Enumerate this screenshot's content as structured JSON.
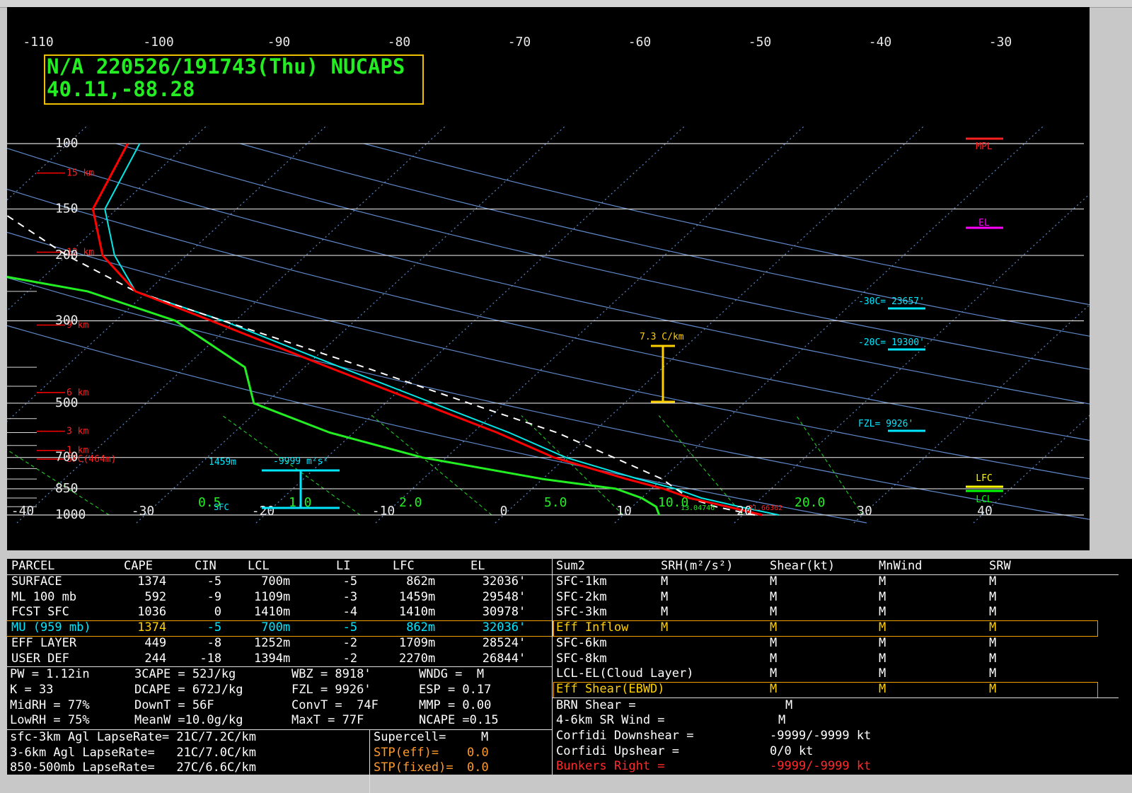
{
  "header": {
    "line1": "N/A 220526/191743(Thu) NUCAPS",
    "line2": "40.11,-88.28"
  },
  "chart_data": {
    "type": "skew-t",
    "pressure_levels": [
      100,
      150,
      200,
      300,
      500,
      700,
      850,
      1000
    ],
    "pressure_ticks_unlabeled": [
      250,
      400,
      450,
      550,
      600,
      650,
      750,
      800,
      900,
      950
    ],
    "temperature_ticks_top": [
      -110,
      -100,
      -90,
      -80,
      -70,
      -60,
      -50,
      -40,
      -30
    ],
    "temperature_ticks_bottom": [
      -40,
      -30,
      -20,
      -10,
      0,
      10,
      20,
      30,
      40
    ],
    "height_labels": [
      "15 km",
      "12 km",
      "9 km",
      "6 km",
      "3 km",
      "1 km",
      "SFC(464m)"
    ],
    "mixing_ratio_labels": [
      "0.5",
      "1.0",
      "2.0",
      "5.0",
      "10.0",
      "20.0"
    ],
    "temperature_profile": [
      [
        1000,
        21.6
      ],
      [
        950,
        18
      ],
      [
        900,
        14
      ],
      [
        850,
        11
      ],
      [
        800,
        7
      ],
      [
        700,
        -1
      ],
      [
        600,
        -8
      ],
      [
        500,
        -17
      ],
      [
        400,
        -28
      ],
      [
        300,
        -42
      ],
      [
        250,
        -51
      ],
      [
        200,
        -57
      ],
      [
        150,
        -62
      ],
      [
        100,
        -65
      ]
    ],
    "virtual_temperature_profile": [
      [
        1000,
        23
      ],
      [
        950,
        19
      ],
      [
        900,
        15
      ],
      [
        850,
        12
      ],
      [
        800,
        8
      ],
      [
        700,
        0
      ],
      [
        600,
        -7
      ],
      [
        500,
        -16
      ],
      [
        400,
        -27
      ],
      [
        300,
        -41
      ],
      [
        250,
        -51
      ],
      [
        200,
        -56
      ],
      [
        150,
        -61
      ],
      [
        100,
        -64
      ]
    ],
    "dewpoint_profile": [
      [
        1000,
        13
      ],
      [
        950,
        12
      ],
      [
        900,
        10
      ],
      [
        850,
        7
      ],
      [
        800,
        0
      ],
      [
        700,
        -12
      ],
      [
        600,
        -22
      ],
      [
        500,
        -31
      ],
      [
        400,
        -35
      ],
      [
        300,
        -45
      ],
      [
        250,
        -55
      ],
      [
        200,
        -75
      ],
      [
        150,
        -83
      ],
      [
        100,
        -90
      ]
    ],
    "parcel_trace": [
      [
        1000,
        21
      ],
      [
        950,
        17
      ],
      [
        900,
        14
      ],
      [
        850,
        12
      ],
      [
        800,
        10
      ],
      [
        700,
        4
      ],
      [
        600,
        -3
      ],
      [
        500,
        -13
      ],
      [
        400,
        -25
      ],
      [
        300,
        -41
      ],
      [
        250,
        -51
      ],
      [
        200,
        -60
      ],
      [
        150,
        -70
      ],
      [
        100,
        -82
      ]
    ],
    "surface_labels": {
      "temperature": "21.66362",
      "dewpoint": "13.04746"
    },
    "lapse_rate_label": "7.3 C/km",
    "effective_inflow": {
      "base_label": "1459m",
      "srh_label": "-9999 m²s²"
    },
    "sfc_label": "SFC",
    "right_markers": [
      {
        "label": "-30C= 23657'",
        "color": "#00e8ff"
      },
      {
        "label": "-20C= 19300'",
        "color": "#00e8ff"
      },
      {
        "label": "FZL= 9926'",
        "color": "#00e8ff"
      },
      {
        "label": "MPL",
        "color": "#ff2020"
      },
      {
        "label": "EL",
        "color": "#ff00ff"
      },
      {
        "label": "LFC",
        "color": "#ffff00"
      },
      {
        "label": "LCL",
        "color": "#00ff00"
      }
    ],
    "colors": {
      "temperature": "#ff0000",
      "virtual_temperature": "#00e8e8",
      "dewpoint": "#22ee22",
      "parcel": "#ffffff",
      "isobar": "#d8d8d8",
      "isotherm": "#5e88c8",
      "mixing_ratio": "#22cc22",
      "height": "#ff0000"
    }
  },
  "parcel_table": {
    "headers": [
      "PARCEL",
      "CAPE",
      "CIN",
      "LCL",
      "LI",
      "LFC",
      "EL"
    ],
    "rows": [
      [
        "SURFACE",
        "1374",
        "-5",
        "700m",
        "-5",
        "862m",
        "32036'"
      ],
      [
        "ML 100 mb",
        "592",
        "-9",
        "1109m",
        "-3",
        "1459m",
        "29548'"
      ],
      [
        "FCST SFC",
        "1036",
        "0",
        "1410m",
        "-4",
        "1410m",
        "30978'"
      ],
      [
        "MU (959 mb)",
        "1374",
        "-5",
        "700m",
        "-5",
        "862m",
        "32036'"
      ],
      [
        "EFF LAYER",
        "449",
        "-8",
        "1252m",
        "-2",
        "1709m",
        "28524'"
      ],
      [
        "USER DEF",
        "244",
        "-18",
        "1394m",
        "-2",
        "2270m",
        "26844'"
      ]
    ]
  },
  "thermo_indices": [
    [
      "PW = 1.12in",
      "3CAPE = 52J/kg",
      "WBZ = 8918'",
      "WNDG =  M"
    ],
    [
      "K = 33",
      "DCAPE = 672J/kg",
      "FZL = 9926'",
      "ESP = 0.17"
    ],
    [
      "MidRH = 77%",
      "DownT = 56F",
      "ConvT =  74F",
      "MMP = 0.00"
    ],
    [
      "LowRH = 75%",
      "MeanW =10.0g/kg",
      "MaxT = 77F",
      "NCAPE =0.15"
    ]
  ],
  "lapse_rates": [
    "sfc-3km Agl LapseRate= 21C/7.2C/km",
    "3-6km Agl LapseRate=   21C/7.0C/km",
    "850-500mb LapseRate=   27C/6.6C/km"
  ],
  "severe_params": [
    {
      "label": "Supercell=",
      "value": "M"
    },
    {
      "label": "STP(eff)=",
      "value": "0.0"
    },
    {
      "label": "STP(fixed)=",
      "value": "0.0"
    }
  ],
  "kinematic_table": {
    "headers": [
      "Sum2",
      "SRH(m²/s²)",
      "Shear(kt)",
      "MnWind",
      "SRW"
    ],
    "rows": [
      [
        "SFC-1km",
        "M",
        "M",
        "M",
        "M"
      ],
      [
        "SFC-2km",
        "M",
        "M",
        "M",
        "M"
      ],
      [
        "SFC-3km",
        "M",
        "M",
        "M",
        "M"
      ],
      [
        "Eff Inflow",
        "M",
        "M",
        "M",
        "M"
      ],
      [
        "SFC-6km",
        "",
        "M",
        "M",
        "M"
      ],
      [
        "SFC-8km",
        "",
        "M",
        "M",
        "M"
      ],
      [
        "LCL-EL(Cloud Layer)",
        "",
        "M",
        "M",
        "M"
      ],
      [
        "Eff Shear(EBWD)",
        "",
        "M",
        "M",
        "M"
      ]
    ]
  },
  "kinematic_extra": [
    {
      "label": "BRN Shear =",
      "value": "M"
    },
    {
      "label": "4-6km SR Wind =",
      "value": "M"
    },
    {
      "label": "Corfidi Downshear =",
      "value": "-9999/-9999 kt"
    },
    {
      "label": "Corfidi Upshear =",
      "value": "0/0 kt"
    },
    {
      "label": "Bunkers Right =",
      "value": "-9999/-9999 kt"
    }
  ]
}
